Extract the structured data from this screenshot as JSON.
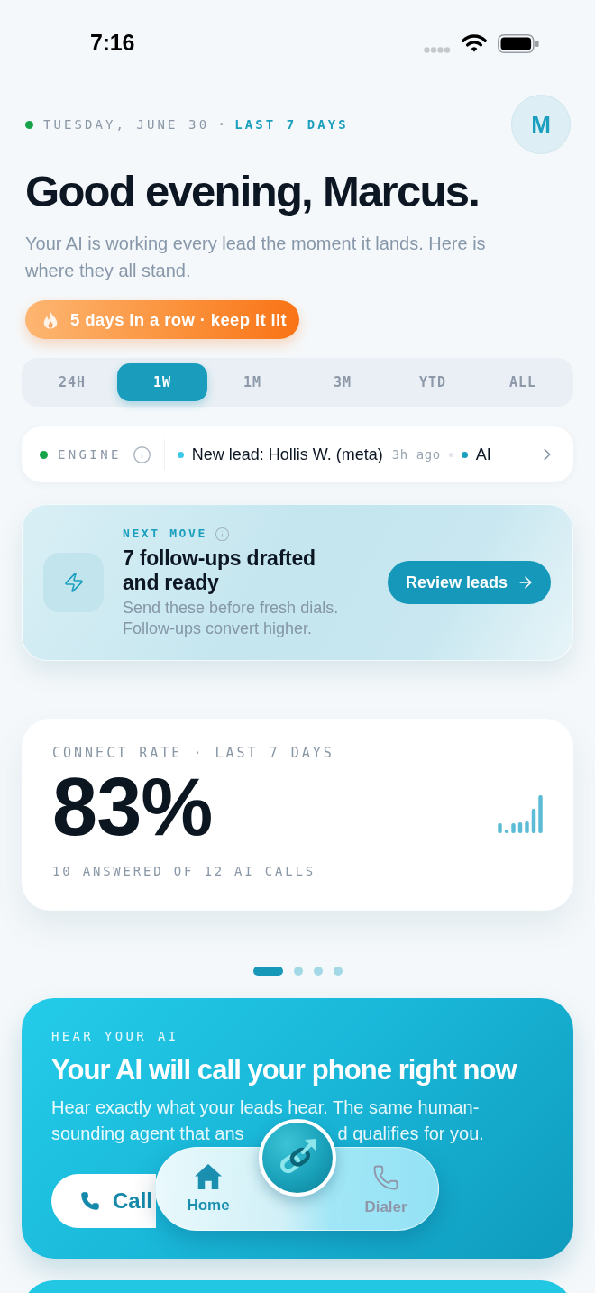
{
  "status_bar": {
    "time": "7:16"
  },
  "header": {
    "date": "TUESDAY, JUNE 30",
    "separator": "·",
    "range": "LAST 7 DAYS",
    "avatar": "M"
  },
  "greeting": {
    "title": "Good evening, Marcus.",
    "subtitle": "Your AI is working every lead the moment it lands. Here is where they all stand."
  },
  "streak": {
    "label": "5 days in a row · keep it lit"
  },
  "range_tabs": [
    {
      "label": "24H",
      "selected": false
    },
    {
      "label": "1W",
      "selected": true
    },
    {
      "label": "1M",
      "selected": false
    },
    {
      "label": "3M",
      "selected": false
    },
    {
      "label": "YTD",
      "selected": false
    },
    {
      "label": "ALL",
      "selected": false
    }
  ],
  "engine": {
    "label": "ENGINE",
    "events": [
      {
        "text": "New lead: Hollis W. (meta)",
        "time": "3h ago",
        "color": "#3cc8e8"
      },
      {
        "text": "AI",
        "color": "#1a9fbe"
      }
    ]
  },
  "next_move": {
    "eyebrow": "NEXT MOVE",
    "title": "7 follow-ups drafted and ready",
    "body": "Send these before fresh dials. Follow-ups convert higher.",
    "button": "Review leads"
  },
  "connect_rate": {
    "label": "CONNECT RATE · LAST 7 DAYS",
    "value": "83%",
    "caption": "10 ANSWERED OF 12 AI CALLS"
  },
  "carousel_pages": [
    {
      "selected": true
    },
    {
      "selected": false
    },
    {
      "selected": false
    },
    {
      "selected": false
    }
  ],
  "hear_ai": {
    "eyebrow": "HEAR YOUR AI",
    "title": "Your AI will call your phone right now",
    "body_fragments": [
      "Hear exactly what your leads hear. The same human-",
      "sounding agent that ans",
      "d qualifies for you."
    ],
    "button": "Call"
  },
  "bottom_nav": {
    "tabs": [
      {
        "label": "Home",
        "selected": true
      },
      {
        "label": "Dialer",
        "selected": false
      }
    ]
  }
}
